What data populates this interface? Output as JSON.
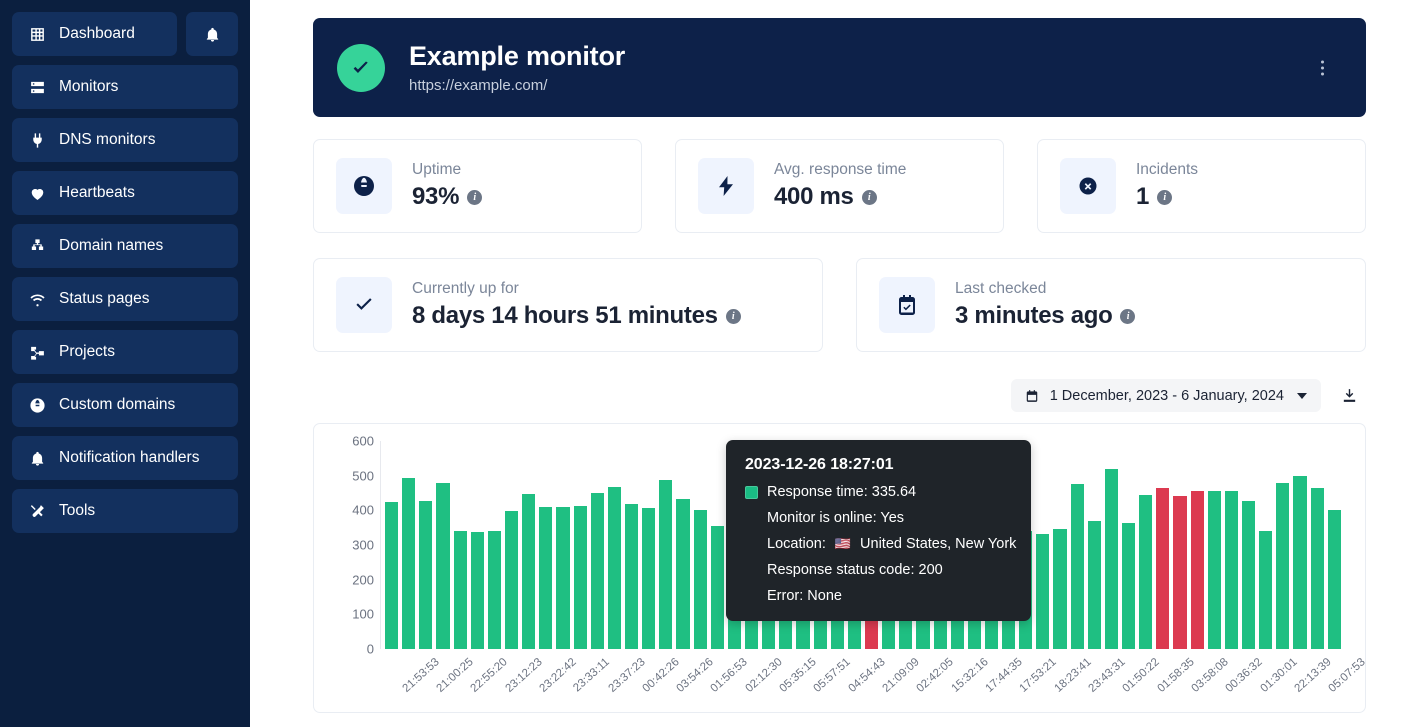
{
  "sidebar": {
    "items": [
      {
        "label": "Dashboard",
        "icon": "grid-icon"
      },
      {
        "label": "Monitors",
        "icon": "server-icon"
      },
      {
        "label": "DNS monitors",
        "icon": "plug-icon"
      },
      {
        "label": "Heartbeats",
        "icon": "heart-pulse-icon"
      },
      {
        "label": "Domain names",
        "icon": "sitemap-icon"
      },
      {
        "label": "Status pages",
        "icon": "wifi-icon"
      },
      {
        "label": "Projects",
        "icon": "project-diagram-icon"
      },
      {
        "label": "Custom domains",
        "icon": "globe-icon"
      },
      {
        "label": "Notification handlers",
        "icon": "bell-icon"
      },
      {
        "label": "Tools",
        "icon": "tools-icon"
      }
    ],
    "notifications_icon": "bell-icon"
  },
  "header": {
    "status": "up",
    "title": "Example monitor",
    "url": "https://example.com/",
    "menu_icon": "kebab-menu-icon"
  },
  "stats": [
    {
      "icon": "globe-icon",
      "label": "Uptime",
      "value": "93%",
      "info": "i"
    },
    {
      "icon": "bolt-icon",
      "label": "Avg. response time",
      "value": "400 ms",
      "info": "i"
    },
    {
      "icon": "times-circle-icon",
      "label": "Incidents",
      "value": "1",
      "info": "i"
    },
    {
      "icon": "check-icon",
      "label": "Currently up for",
      "value": "8 days 14 hours 51 minutes",
      "info": "i"
    },
    {
      "icon": "calendar-check-icon",
      "label": "Last checked",
      "value": "3 minutes ago",
      "info": "i"
    }
  ],
  "toolbar": {
    "calendar_icon": "calendar-icon",
    "range_label": "1 December, 2023 - 6 January, 2024",
    "dropdown_icon": "chevron-down-icon",
    "download_icon": "download-icon"
  },
  "tooltip": {
    "timestamp": "2023-12-26 18:27:01",
    "response_time": "Response time: 335.64",
    "online": "Monitor is online: Yes",
    "location_label": "Location:",
    "location_flag": "🇺🇸",
    "location_value": "United States, New York",
    "status_code": "Response status code: 200",
    "error": "Error: None",
    "swatch_color": "#1abc84"
  },
  "colors": {
    "sidebar_bg": "#0b1f3f",
    "nav_item_bg": "#13305e",
    "header_bg": "#0d2149",
    "up_green": "#36d399",
    "bar_green": "#1fbf82",
    "bar_red": "#dc3a50",
    "tooltip_bg": "#1f2429"
  },
  "chart_data": {
    "type": "bar",
    "title": "",
    "xlabel": "",
    "ylabel": "",
    "ylim": [
      0,
      600
    ],
    "yticks": [
      0,
      100,
      200,
      300,
      400,
      500,
      600
    ],
    "grid": false,
    "legend": "none",
    "categories": [
      "21:53:53",
      "21:00:25",
      "22:55:20",
      "23:12:23",
      "23:22:42",
      "23:33:11",
      "23:37:23",
      "00:42:26",
      "03:54:26",
      "01:56:53",
      "02:12:30",
      "05:35:15",
      "05:57:51",
      "04:54:43",
      "21:09:09",
      "02:42:05",
      "15:32:16",
      "17:44:35",
      "17:53:21",
      "18:23:41",
      "23:43:31",
      "01:50:22",
      "01:58:35",
      "03:58:08",
      "00:36:32",
      "01:30:01",
      "22:13:39",
      "05:07:53"
    ],
    "tick_every": 2,
    "values": [
      423,
      494,
      428,
      479,
      341,
      337,
      340,
      398,
      448,
      410,
      409,
      412,
      450,
      466,
      419,
      406,
      488,
      433,
      400,
      354,
      385,
      427,
      417,
      390,
      342,
      349,
      374,
      367,
      340,
      396,
      361,
      439,
      368,
      350,
      354,
      478,
      345,
      341,
      332,
      345,
      477,
      368,
      518,
      364,
      444,
      465,
      442,
      457,
      456,
      457,
      427,
      341,
      478,
      500,
      465,
      400
    ],
    "states": [
      "up",
      "up",
      "up",
      "up",
      "up",
      "up",
      "up",
      "up",
      "up",
      "up",
      "up",
      "up",
      "up",
      "up",
      "up",
      "up",
      "up",
      "up",
      "up",
      "up",
      "up",
      "up",
      "up",
      "up",
      "up",
      "up",
      "up",
      "up",
      "down",
      "up",
      "up",
      "up",
      "up",
      "up",
      "up",
      "up",
      "up",
      "up",
      "up",
      "up",
      "up",
      "up",
      "up",
      "up",
      "up",
      "down",
      "down",
      "down",
      "up",
      "up",
      "up",
      "up",
      "up",
      "up",
      "up",
      "up"
    ],
    "highlight_index": 28
  }
}
